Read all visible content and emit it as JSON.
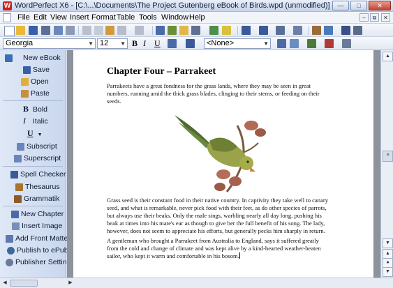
{
  "window": {
    "title": "WordPerfect X6 - [C:\\...\\Documents\\The Project Gutenberg eBook of Birds.wpd (unmodified)]",
    "app_icon_letter": "W",
    "minimize_icon": "minimize-icon",
    "maximize_icon": "maximize-icon",
    "close_icon": "close-icon"
  },
  "menu": {
    "items": [
      "File",
      "Edit",
      "View",
      "Insert",
      "Format",
      "Table",
      "Tools",
      "Window",
      "Help"
    ]
  },
  "toolbar": {
    "font_name": "Georgia",
    "font_size": "12",
    "bold": "B",
    "italic": "I",
    "underline": "U",
    "style": "<None>"
  },
  "sidebar": {
    "items": [
      {
        "label": "New eBook",
        "icon": "new-ebook-icon"
      },
      {
        "label": "Save",
        "icon": "save-icon"
      },
      {
        "label": "Open",
        "icon": "open-icon"
      },
      {
        "label": "Paste",
        "icon": "paste-icon"
      },
      {
        "label": "Bold",
        "icon": "bold-icon"
      },
      {
        "label": "Italic",
        "icon": "italic-icon"
      },
      {
        "label": "",
        "icon": "underline-icon"
      },
      {
        "label": "Subscript",
        "icon": "subscript-icon"
      },
      {
        "label": "Superscript",
        "icon": "superscript-icon"
      },
      {
        "label": "Spell Checker",
        "icon": "spell-checker-icon"
      },
      {
        "label": "Thesaurus",
        "icon": "thesaurus-icon"
      },
      {
        "label": "Grammatik",
        "icon": "grammatik-icon"
      },
      {
        "label": "New Chapter",
        "icon": "new-chapter-icon"
      },
      {
        "label": "Insert Image",
        "icon": "insert-image-icon"
      },
      {
        "label": "Add Front Matter",
        "icon": "front-matter-icon"
      },
      {
        "label": "Publish to ePub",
        "icon": "publish-icon"
      },
      {
        "label": "Publisher Settings",
        "icon": "settings-icon"
      }
    ],
    "underline_label": "U"
  },
  "document": {
    "heading": "Chapter Four – Parrakeet",
    "para1": [
      "Parrakeets have a great fondness for the grass lands, where they may be seen in great",
      "numbers, running amid the thick grass blades, clinging to their stems, or feeding on their",
      "seeds."
    ],
    "para2": [
      "Grass seed is their constant food in their native country. In captivity they take well to canary",
      "seed, and what is remarkable, never pick food with their feet, as do other species of parrots,",
      "but always use their beaks. Only the male sings, warbling nearly all day long, pushing his",
      "beak at times into his mate's ear as though to give her the full benefit of his song. The lady,",
      "however, does not seem to appreciate his efforts, but generally pecks him sharply in return."
    ],
    "para3": [
      "A gentleman who brought a Parrakeet from Australia to England, says it suffered greatly",
      "from the cold and change of climate and was kept alive by a kind-hearted weather-beaten",
      "sailor, who kept it warm and comfortable in his bosom."
    ]
  },
  "colors": {
    "accent": "#c8231f",
    "sidebar_bg": "#c9d7ee",
    "doc_bg": "#8d929b"
  }
}
